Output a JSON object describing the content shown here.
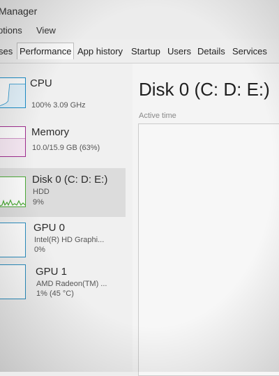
{
  "window": {
    "title": "Manager"
  },
  "menu": {
    "options": "ptions",
    "view": "View"
  },
  "tabs": [
    {
      "label": "ses"
    },
    {
      "label": "Performance"
    },
    {
      "label": "App history"
    },
    {
      "label": "Startup"
    },
    {
      "label": "Users"
    },
    {
      "label": "Details"
    },
    {
      "label": "Services"
    }
  ],
  "sidebar": {
    "items": [
      {
        "name": "CPU",
        "line1": "100% 3.09 GHz",
        "color": "#1b8ec9"
      },
      {
        "name": "Memory",
        "line1": "10.0/15.9 GB (63%)",
        "color": "#a02e8f"
      },
      {
        "name": "Disk 0 (C: D: E:)",
        "line1": "HDD",
        "line2": "9%",
        "color": "#4caa37"
      },
      {
        "name": "GPU 0",
        "line1": "Intel(R) HD Graphi...",
        "line2": "0%",
        "color": "#2a8dbf"
      },
      {
        "name": "GPU 1",
        "line1": "AMD Radeon(TM) ...",
        "line2": "1% (45 °C)",
        "color": "#2a8dbf"
      }
    ]
  },
  "main": {
    "title": "Disk 0 (C: D: E:)",
    "active_time_label": "Active time"
  }
}
